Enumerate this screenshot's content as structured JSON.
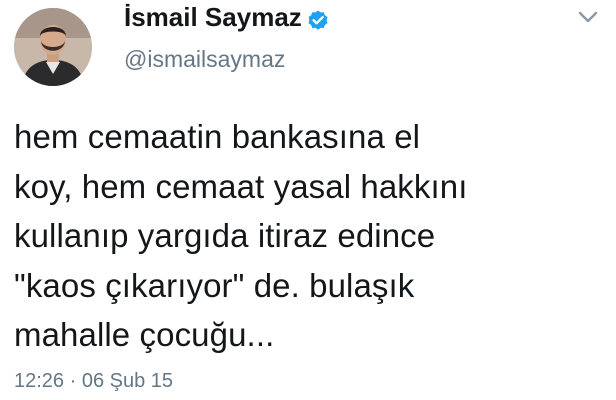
{
  "author": {
    "name": "İsmail Saymaz",
    "handle": "@ismailsaymaz",
    "verified": true
  },
  "tweet": {
    "text": "hem cemaatin bankasına el\nkoy, hem cemaat yasal hakkını\nkullanıp yargıda itiraz edince\n\"kaos çıkarıyor\" de. bulaşık\nmahalle çocuğu...",
    "time": "12:26",
    "separator": "·",
    "date": "06 Şub 15"
  },
  "icons": {
    "verified": "verified-badge-icon",
    "menu": "chevron-down-icon"
  },
  "colors": {
    "verified_blue": "#1da1f2",
    "text": "#14171a",
    "muted": "#657786"
  }
}
